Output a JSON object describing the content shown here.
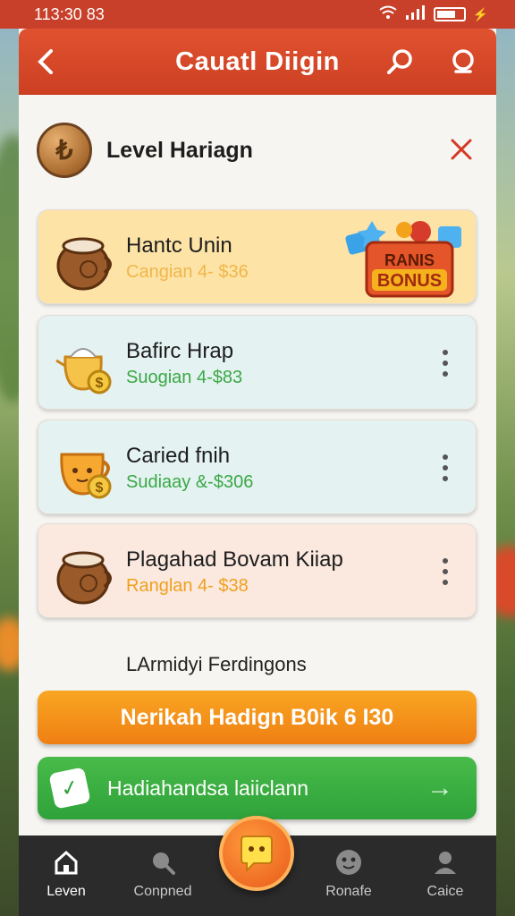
{
  "status_bar": {
    "time": "113:30 83"
  },
  "header": {
    "title": "Cauatl Diigin"
  },
  "panel": {
    "title": "Level Hariagn"
  },
  "cards": [
    {
      "name": "Hantc Unin",
      "sub": "Cangian 4- $36",
      "sub_color": "#f0b64a",
      "bg": "#fde3a6",
      "badge": {
        "line1": "RANIS",
        "line2": "BONUS"
      }
    },
    {
      "name": "Bafirc Hrap",
      "sub": "Suogian 4-$83",
      "sub_color": "#3aa845",
      "bg": "#e4f2f1"
    },
    {
      "name": "Caried fnih",
      "sub": "Sudiaay &-$306",
      "sub_color": "#3aa845",
      "bg": "#e4f2f1"
    },
    {
      "name": "Plagahad Bovam Kiiap",
      "sub": "Ranglan 4- $38",
      "sub_color": "#f0a01f",
      "bg": "#fbe9df"
    }
  ],
  "section_label": "LArmidyi Ferdingons",
  "primary_button": {
    "label": "Nerikah Hadign B0ik 6 I30"
  },
  "secondary_button": {
    "label": "Hadiahandsa laiiclann"
  },
  "bottom_nav": [
    {
      "label": "Leven",
      "icon": "home-icon"
    },
    {
      "label": "Conpned",
      "icon": "search-icon"
    },
    {
      "label": "Ronafe",
      "icon": "face-icon"
    },
    {
      "label": "Caice",
      "icon": "user-icon"
    }
  ]
}
